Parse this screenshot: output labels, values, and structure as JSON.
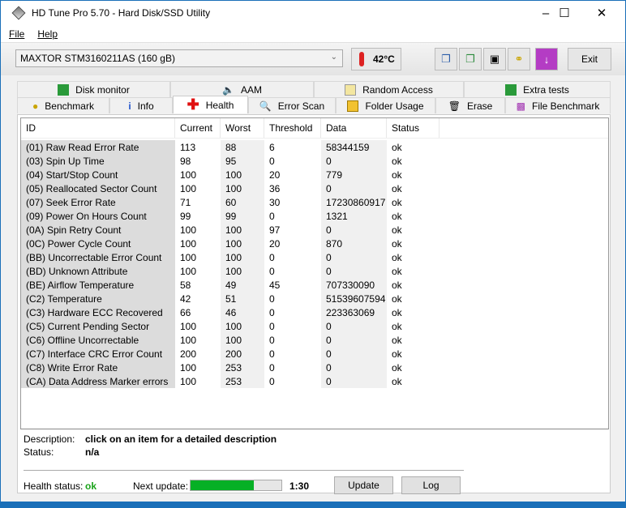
{
  "window": {
    "title": "HD Tune Pro 5.70 - Hard Disk/SSD Utility"
  },
  "menu": [
    "File",
    "Help"
  ],
  "toolbar": {
    "drive": "MAXTOR STM3160211AS (160 gB)",
    "temperature": "42°C",
    "exit": "Exit"
  },
  "tabs_top": [
    "Disk monitor",
    "AAM",
    "Random Access",
    "Extra tests"
  ],
  "tabs_bottom": [
    "Benchmark",
    "Info",
    "Health",
    "Error Scan",
    "Folder Usage",
    "Erase",
    "File Benchmark"
  ],
  "table": {
    "headers": [
      "ID",
      "Current",
      "Worst",
      "Threshold",
      "Data",
      "Status"
    ],
    "rows": [
      [
        "(01) Raw Read Error Rate",
        "113",
        "88",
        "6",
        "58344159",
        "ok"
      ],
      [
        "(03) Spin Up Time",
        "98",
        "95",
        "0",
        "0",
        "ok"
      ],
      [
        "(04) Start/Stop Count",
        "100",
        "100",
        "20",
        "779",
        "ok"
      ],
      [
        "(05) Reallocated Sector Count",
        "100",
        "100",
        "36",
        "0",
        "ok"
      ],
      [
        "(07) Seek Error Rate",
        "71",
        "60",
        "30",
        "17230860917",
        "ok"
      ],
      [
        "(09) Power On Hours Count",
        "99",
        "99",
        "0",
        "1321",
        "ok"
      ],
      [
        "(0A) Spin Retry Count",
        "100",
        "100",
        "97",
        "0",
        "ok"
      ],
      [
        "(0C) Power Cycle Count",
        "100",
        "100",
        "20",
        "870",
        "ok"
      ],
      [
        "(BB) Uncorrectable Error Count",
        "100",
        "100",
        "0",
        "0",
        "ok"
      ],
      [
        "(BD) Unknown Attribute",
        "100",
        "100",
        "0",
        "0",
        "ok"
      ],
      [
        "(BE) Airflow Temperature",
        "58",
        "49",
        "45",
        "707330090",
        "ok"
      ],
      [
        "(C2) Temperature",
        "42",
        "51",
        "0",
        "51539607594",
        "ok"
      ],
      [
        "(C3) Hardware ECC Recovered",
        "66",
        "46",
        "0",
        "223363069",
        "ok"
      ],
      [
        "(C5) Current Pending Sector",
        "100",
        "100",
        "0",
        "0",
        "ok"
      ],
      [
        "(C6) Offline Uncorrectable",
        "100",
        "100",
        "0",
        "0",
        "ok"
      ],
      [
        "(C7) Interface CRC Error Count",
        "200",
        "200",
        "0",
        "0",
        "ok"
      ],
      [
        "(C8) Write Error Rate",
        "100",
        "253",
        "0",
        "0",
        "ok"
      ],
      [
        "(CA) Data Address Marker errors",
        "100",
        "253",
        "0",
        "0",
        "ok"
      ]
    ]
  },
  "details": {
    "description_label": "Description:",
    "description": "click on an item for a detailed description",
    "status_label": "Status:",
    "status": "n/a"
  },
  "footer": {
    "health_label": "Health status:",
    "health": "ok",
    "next_label": "Next update:",
    "progress_percent": 70,
    "time": "1:30",
    "update": "Update",
    "log": "Log"
  },
  "colors": {
    "ok": "#1aa31a",
    "progress": "#06b025"
  }
}
